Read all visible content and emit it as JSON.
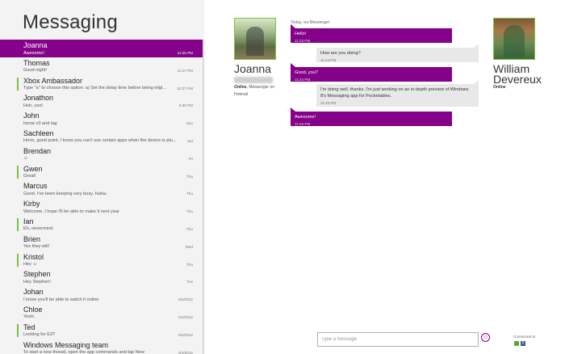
{
  "app": {
    "title": "Messaging"
  },
  "conversations": [
    {
      "name": "Joanna",
      "snippet": "Awesome!",
      "time": "11:25 PM",
      "selected": true,
      "online": false
    },
    {
      "name": "Thomas",
      "snippet": "Good night!",
      "time": "11:17 PM",
      "online": false
    },
    {
      "name": "Xbox Ambassador",
      "snippet": "Type \"a\" to choose this option: a) Set the delay time before being eligi...",
      "time": "10:27 PM",
      "online": true
    },
    {
      "name": "Jonathon",
      "snippet": "Huh, cool",
      "time": "6:30 PM",
      "online": false
    },
    {
      "name": "John",
      "snippet": "horse x3 and tag",
      "time": "Sun",
      "online": false
    },
    {
      "name": "Sachleen",
      "snippet": "Hmm, good point, I know you can't use certain apps when the device is plu...",
      "time": "Sat",
      "online": false
    },
    {
      "name": "Brendan",
      "snippet": "☺",
      "time": "Fri",
      "online": false
    },
    {
      "name": "Gwen",
      "snippet": "Great!",
      "time": "Thu",
      "online": true
    },
    {
      "name": "Marcus",
      "snippet": "Good. I've been keeping very busy. Haha.",
      "time": "Thu",
      "online": false
    },
    {
      "name": "Kirby",
      "snippet": "Welcome, I hope I'll be able to make it next year",
      "time": "Thu",
      "online": false
    },
    {
      "name": "Ian",
      "snippet": "Eh, nevermind.",
      "time": "Thu",
      "online": true
    },
    {
      "name": "Brien",
      "snippet": "Yes they will!",
      "time": "Wed",
      "online": false
    },
    {
      "name": "Kristol",
      "snippet": "Hey ☺",
      "time": "Thu",
      "online": true
    },
    {
      "name": "Stephen",
      "snippet": "Hey Stephen!",
      "time": "Tue",
      "online": false
    },
    {
      "name": "Johan",
      "snippet": "I know you'll be able to watch it online",
      "time": "6/4/2012",
      "online": false
    },
    {
      "name": "Chloe",
      "snippet": "Yeah.",
      "time": "6/4/2012",
      "online": false
    },
    {
      "name": "Ted",
      "snippet": "Looking for E3?",
      "time": "6/4/2012",
      "online": true
    },
    {
      "name": "Windows Messaging team",
      "snippet": "To start a new thread, open the app commands and tap New",
      "time": "6/4/2012",
      "online": false
    }
  ],
  "contact_left": {
    "name": "Joanna",
    "status": "Online",
    "status_detail": ", Messenger on Hotmail"
  },
  "contact_right": {
    "first": "William",
    "last": "Devereux",
    "status": "Online"
  },
  "conversation": {
    "header": "Today, via Messenger",
    "messages": [
      {
        "dir": "out",
        "text": "Hello!",
        "time": "11:24 PM"
      },
      {
        "dir": "in",
        "text": "How are you doing?",
        "time": "11:24 PM"
      },
      {
        "dir": "out",
        "text": "Good, you?",
        "time": "11:24 PM"
      },
      {
        "dir": "in",
        "text": "I'm doing well, thanks. I'm just working on an in-depth preview of Windows 8's Messaging app for Pocketables.",
        "time": "11:25 PM"
      },
      {
        "dir": "out",
        "text": "Awesome!",
        "time": "11:25 PM"
      }
    ]
  },
  "compose": {
    "placeholder": "Type a message",
    "value": ""
  },
  "footer": {
    "connected_label": "Connected to",
    "services": [
      "xbox-icon",
      "facebook-icon"
    ]
  },
  "colors": {
    "accent": "#86018a",
    "online": "#7ac143",
    "incoming": "#e8e8e8",
    "sidebar_bg": "#f3f3f3"
  },
  "icons": {
    "emoji": "smiley-icon"
  }
}
